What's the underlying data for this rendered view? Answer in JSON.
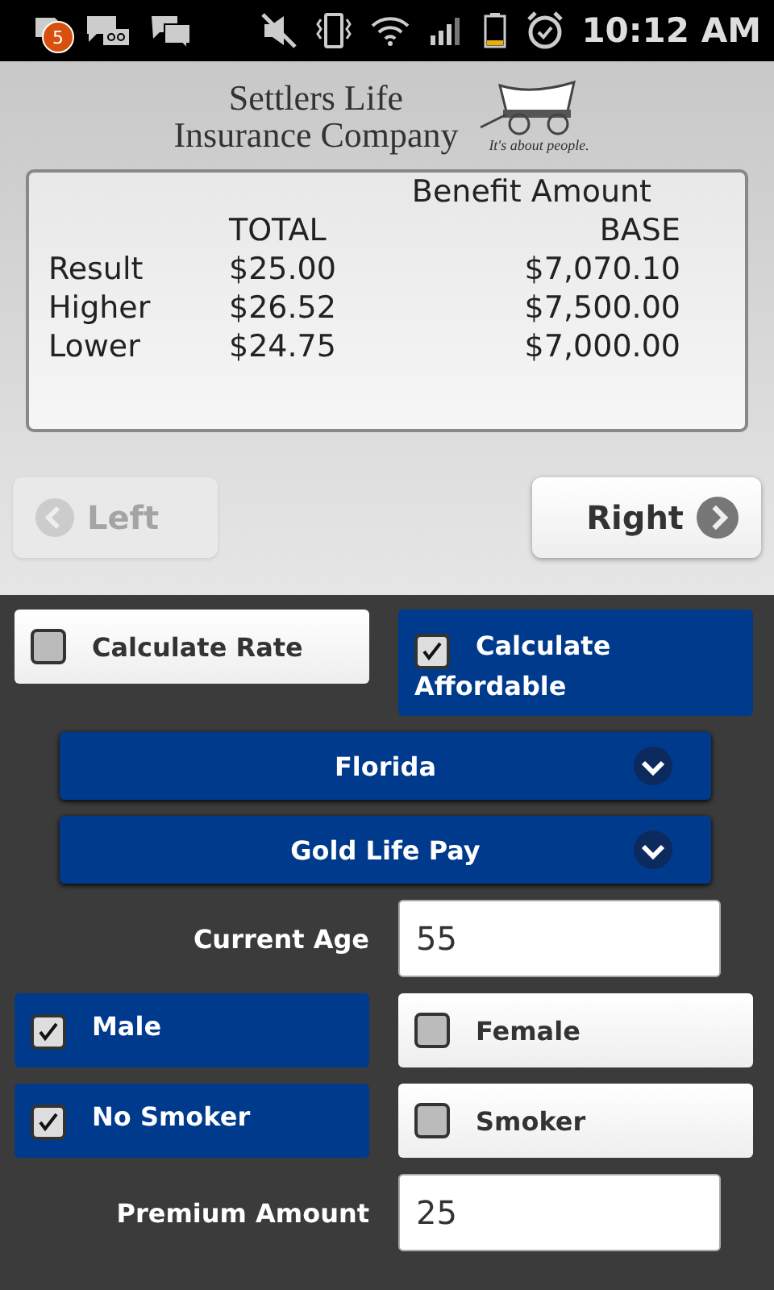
{
  "status_bar": {
    "notification_count": "5",
    "time": "10:12 AM"
  },
  "logo": {
    "line1": "Settlers Life",
    "line2": "Insurance Company",
    "tagline": "It's about people."
  },
  "results": {
    "group_header": "Benefit Amount",
    "columns": [
      "TOTAL",
      "BASE"
    ],
    "rows": [
      {
        "label": "Result",
        "total": "$25.00",
        "base": "$7,070.10"
      },
      {
        "label": "Higher",
        "total": "$26.52",
        "base": "$7,500.00"
      },
      {
        "label": "Lower",
        "total": "$24.75",
        "base": "$7,000.00"
      }
    ]
  },
  "nav": [
    {
      "label": "Left",
      "kind": "back",
      "disabled": true
    },
    {
      "label": "Right",
      "kind": "forward",
      "disabled": false
    }
  ],
  "modes": [
    {
      "label": "Calculate Rate",
      "checked": false
    },
    {
      "label": "Calculate Affordable",
      "checked": true
    }
  ],
  "dropdowns": [
    {
      "value": "Florida"
    },
    {
      "value": "Gold Life Pay"
    }
  ],
  "age": {
    "label": "Current Age",
    "value": "55"
  },
  "gender": [
    {
      "label": "Male",
      "checked": true
    },
    {
      "label": "Female",
      "checked": false
    }
  ],
  "smoker": [
    {
      "label": "No Smoker",
      "checked": true
    },
    {
      "label": "Smoker",
      "checked": false
    }
  ],
  "premium": {
    "label": "Premium Amount",
    "value": "25"
  }
}
